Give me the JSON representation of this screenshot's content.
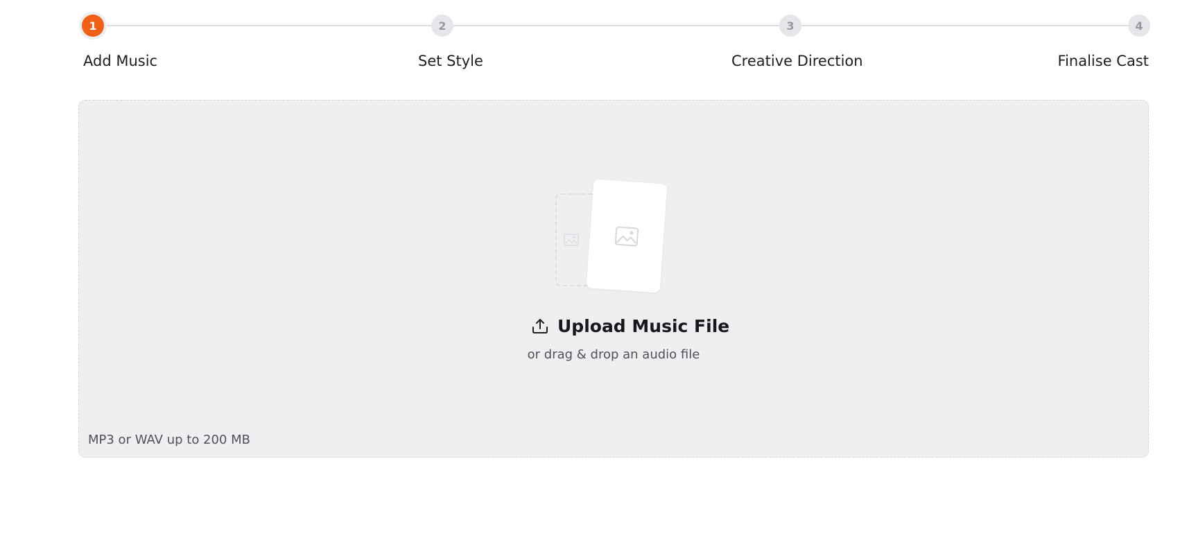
{
  "stepper": {
    "steps": [
      {
        "number": "1",
        "label": "Add Music",
        "state": "active"
      },
      {
        "number": "2",
        "label": "Set Style",
        "state": "inactive"
      },
      {
        "number": "3",
        "label": "Creative Direction",
        "state": "inactive"
      },
      {
        "number": "4",
        "label": "Finalise Cast",
        "state": "inactive"
      }
    ]
  },
  "upload": {
    "title": "Upload Music File",
    "subtitle": "or drag & drop an audio file",
    "hint": "MP3 or WAV up to 200 MB",
    "icons": [
      "upload-icon",
      "image-placeholder-icon"
    ]
  },
  "colors": {
    "accent": "#f26018",
    "inactive_step": "#e6e6ea",
    "dropzone_bg": "#efeff1"
  }
}
